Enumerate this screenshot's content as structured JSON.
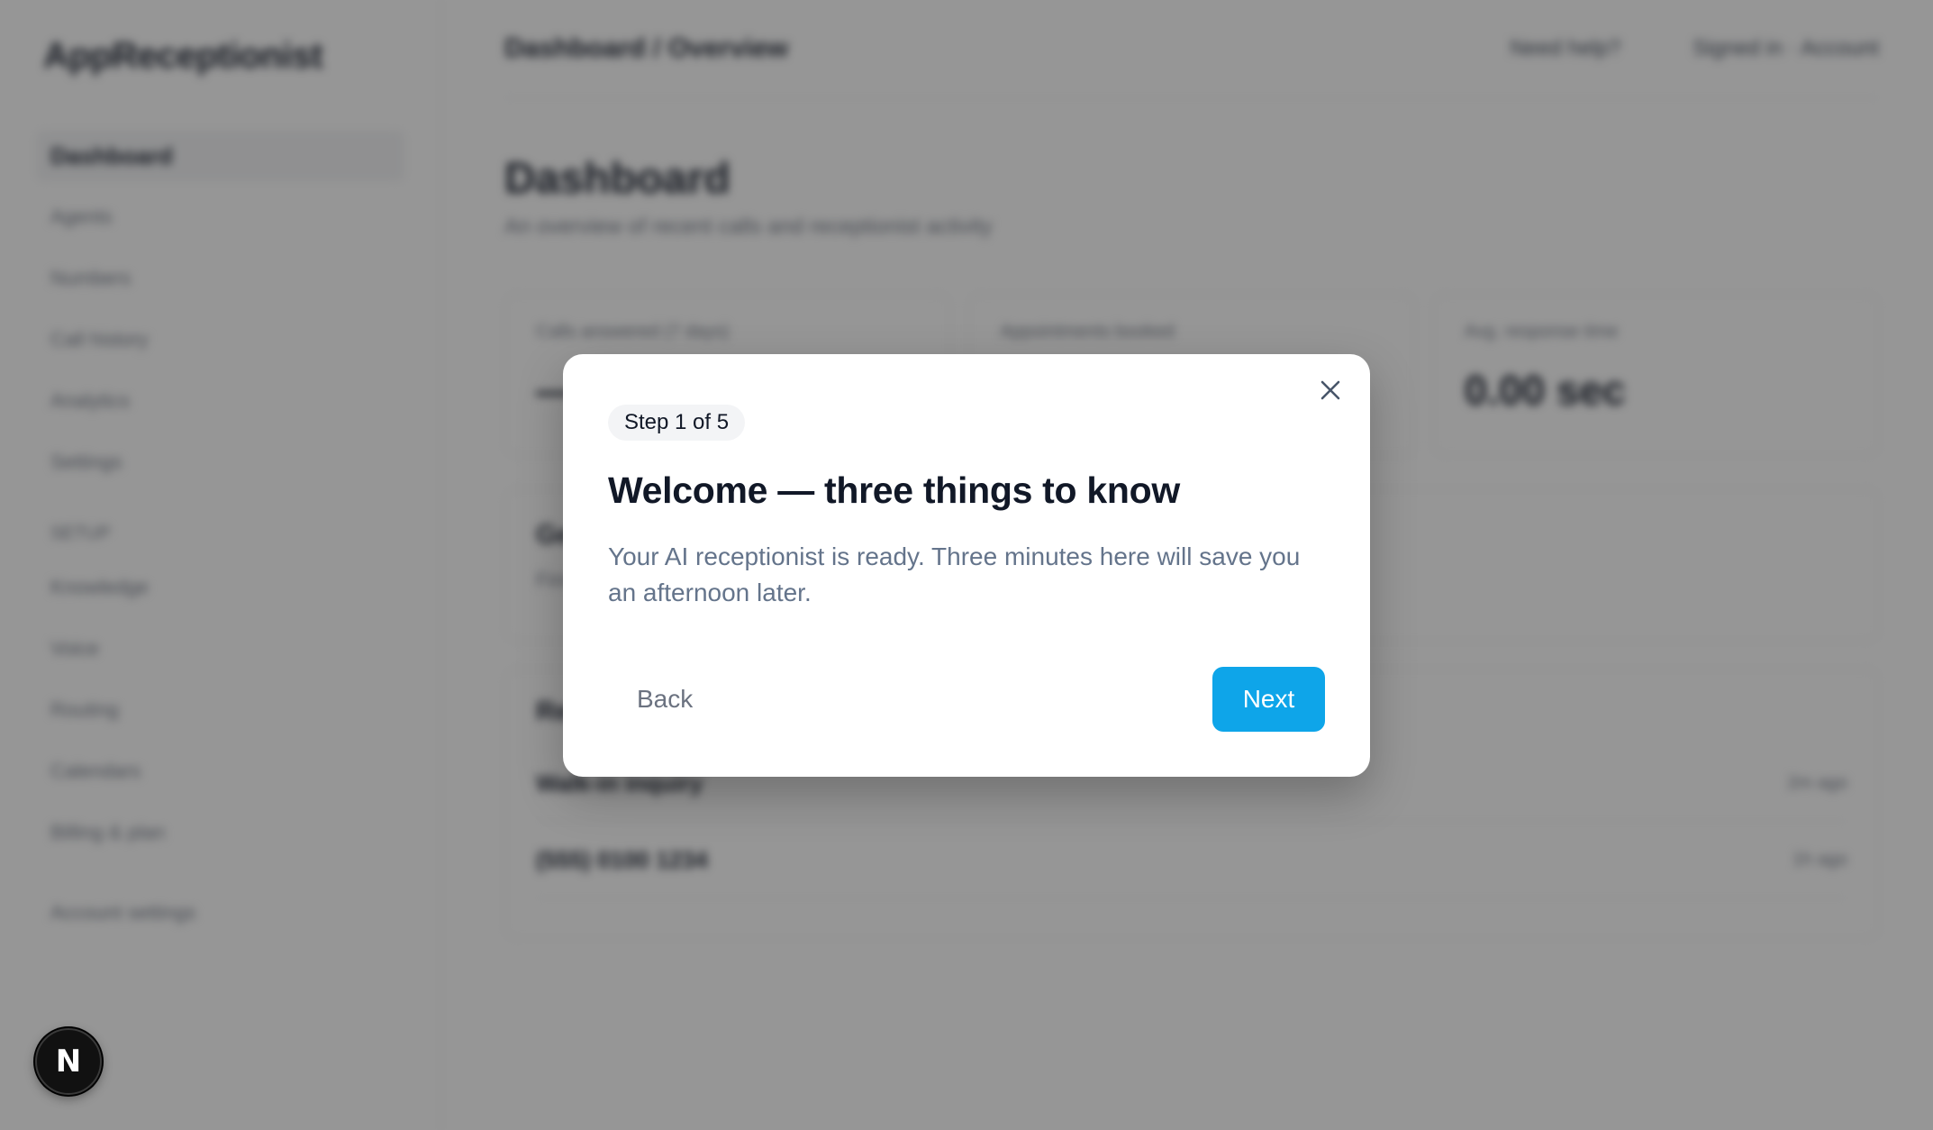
{
  "background": {
    "app_name": "AppReceptionist",
    "topbar": {
      "crumb": "Dashboard / Overview",
      "links": [
        "Need help?",
        "Signed in · Account"
      ]
    },
    "sidebar": {
      "nav": [
        "Dashboard",
        "Agents",
        "Numbers",
        "Call history",
        "Analytics",
        "Settings"
      ],
      "section_label": "Setup",
      "setup_items": [
        "Knowledge",
        "Voice",
        "Routing",
        "Calendars",
        "Billing & plan"
      ],
      "footer": "Account settings"
    },
    "page": {
      "title": "Dashboard",
      "subtitle": "An overview of recent calls and receptionist activity",
      "stats": [
        {
          "label": "Calls answered (7 days)",
          "value": "—"
        },
        {
          "label": "Appointments booked",
          "value": "—"
        },
        {
          "label": "Avg. response time",
          "value": "0.00 sec"
        }
      ],
      "panel": {
        "title": "Getting started",
        "subtitle": "Finish setup to start taking calls"
      },
      "table": {
        "title": "Recent calls",
        "rows": [
          {
            "name": "Walk-in inquiry",
            "meta": "2m ago"
          },
          {
            "name": "(555) 0100 1234",
            "meta": "1h ago"
          }
        ]
      }
    }
  },
  "modal": {
    "step_label": "Step 1 of 5",
    "title": "Welcome — three things to know",
    "body": "Your AI receptionist is ready. Three minutes here will save you an afternoon later.",
    "back_label": "Back",
    "next_label": "Next",
    "close_icon": "close-icon",
    "accent_color": "#0ea5e9"
  },
  "fab": {
    "label": "N",
    "icon": "nextjs-badge-icon"
  }
}
